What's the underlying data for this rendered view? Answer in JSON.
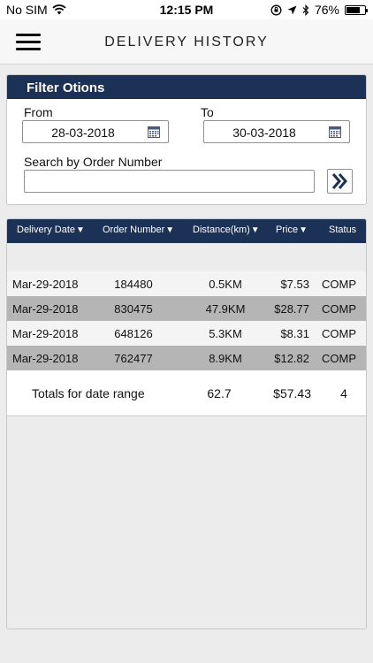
{
  "status_bar": {
    "carrier": "No SIM",
    "time": "12:15 PM",
    "battery": "76%",
    "battery_level": 0.76
  },
  "nav": {
    "title": "DELIVERY HISTORY",
    "menu_icon": "hamburger-menu-icon"
  },
  "filter": {
    "header": "Filter Otions",
    "from_label": "From",
    "from_value": "28-03-2018",
    "to_label": "To",
    "to_value": "30-03-2018",
    "search_label": "Search by Order Number",
    "search_value": "",
    "search_placeholder": "",
    "go_icon": "double-chevron-right-icon"
  },
  "table": {
    "headers": {
      "date": "Delivery Date",
      "order": "Order Number",
      "distance": "Distance(km)",
      "price": "Price",
      "status": "Status"
    },
    "sort_icon": "triangle-down-icon",
    "rows": [
      {
        "date": "Mar-29-2018",
        "order": "184480",
        "distance": "0.5KM",
        "price": "$7.53",
        "status": "COMP"
      },
      {
        "date": "Mar-29-2018",
        "order": "830475",
        "distance": "47.9KM",
        "price": "$28.77",
        "status": "COMP"
      },
      {
        "date": "Mar-29-2018",
        "order": "648126",
        "distance": "5.3KM",
        "price": "$8.31",
        "status": "COMP"
      },
      {
        "date": "Mar-29-2018",
        "order": "762477",
        "distance": "8.9KM",
        "price": "$12.82",
        "status": "COMP"
      }
    ],
    "totals": {
      "label": "Totals for date range",
      "distance": "62.7",
      "price": "$57.43",
      "count": "4"
    }
  },
  "colors": {
    "header_navy": "#1c3156",
    "row_light": "#f4f4f4",
    "row_dark": "#b5b5b5",
    "background": "#ececec"
  }
}
